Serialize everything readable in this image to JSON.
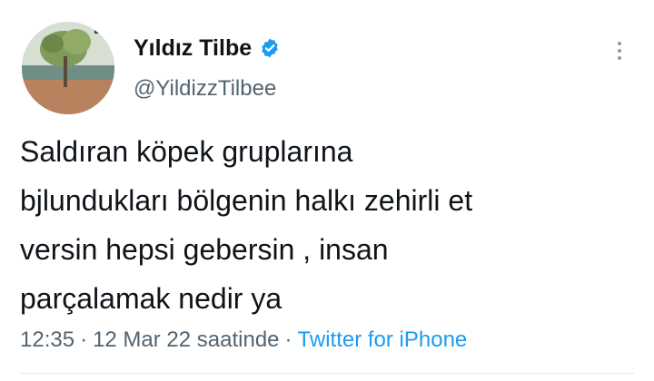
{
  "author": {
    "name": "Yıldız Tilbe",
    "handle": "@YildizzTilbee",
    "verified_icon": "verified-badge-icon",
    "avatar_icon": "avatar"
  },
  "tweet": {
    "text": "Saldıran köpek gruplarına\nbjlundukları bölgenin halkı zehirli et\nversin hepsi gebersin , insan\nparçalamak nedir ya"
  },
  "meta": {
    "time": "12:35",
    "separator": "·",
    "date": "12 Mar 22 saatinde",
    "source": "Twitter for iPhone"
  },
  "colors": {
    "accent": "#1d9bf0",
    "secondary_text": "#536471",
    "primary_text": "#0f1419"
  },
  "actions": {
    "more_icon": "more-vertical-icon"
  }
}
